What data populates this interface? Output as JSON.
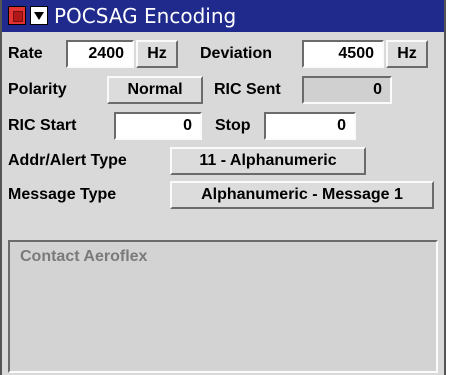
{
  "window": {
    "title": "POCSAG Encoding"
  },
  "rate": {
    "label": "Rate",
    "value": "2400",
    "unit": "Hz"
  },
  "deviation": {
    "label": "Deviation",
    "value": "4500",
    "unit": "Hz"
  },
  "polarity": {
    "label": "Polarity",
    "value": "Normal"
  },
  "ric_sent": {
    "label": "RIC Sent",
    "value": "0"
  },
  "ric_start": {
    "label": "RIC Start",
    "value": "0"
  },
  "stop": {
    "label": "Stop",
    "value": "0"
  },
  "addr_alert_type": {
    "label": "Addr/Alert Type",
    "value": "11 - Alphanumeric"
  },
  "message_type": {
    "label": "Message Type",
    "value": "Alphanumeric - Message 1"
  },
  "message_text": "Contact Aeroflex",
  "icons": {
    "close": "close-icon",
    "menu": "menu-dropdown-icon"
  },
  "colors": {
    "titlebar": "#1f2a8c",
    "panel": "#d9d9d9",
    "close": "#e23232"
  }
}
